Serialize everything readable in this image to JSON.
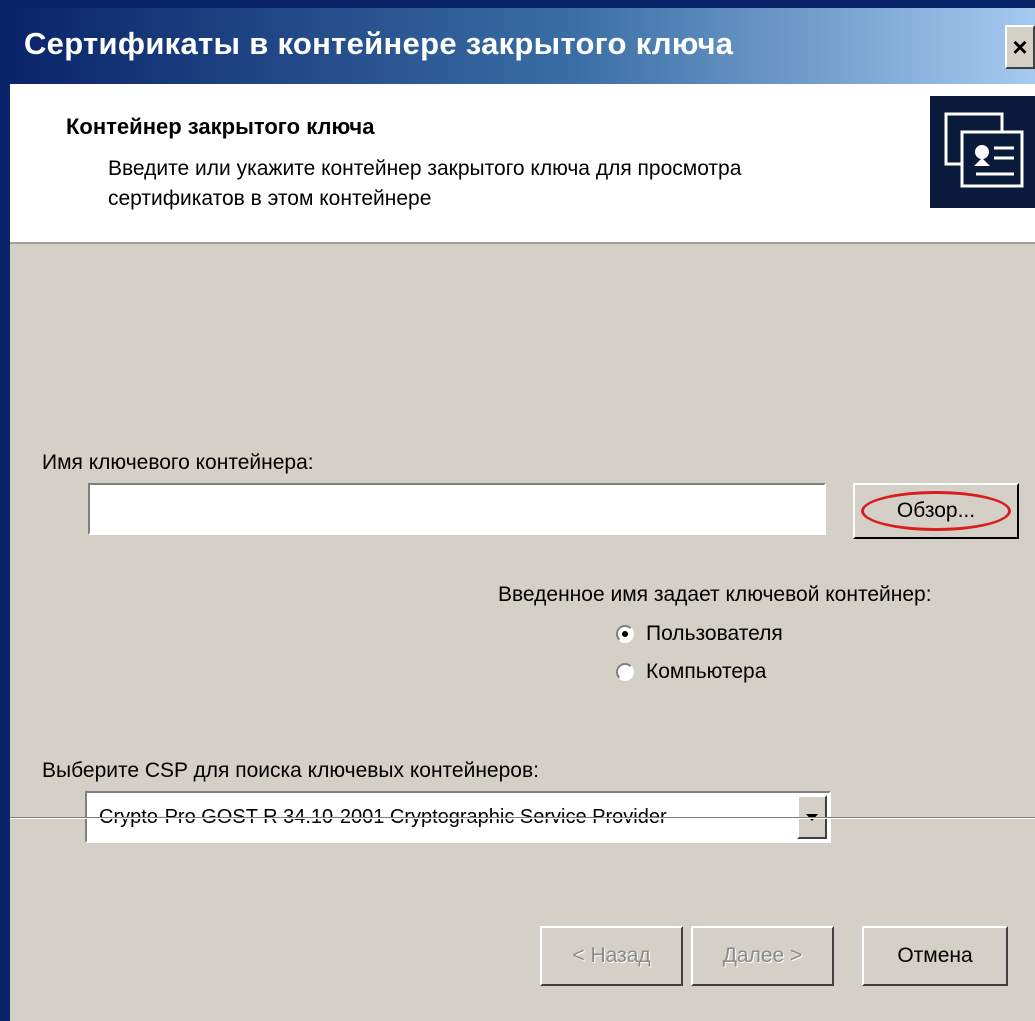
{
  "window": {
    "title": "Сертификаты в контейнере закрытого ключа",
    "close_label": "×"
  },
  "header": {
    "title": "Контейнер закрытого ключа",
    "description": "Введите или укажите контейнер закрытого ключа для просмотра сертификатов в этом контейнере",
    "icon": "certificate-icon"
  },
  "container": {
    "label": "Имя ключевого контейнера:",
    "value": "",
    "browse_label": "Обзор..."
  },
  "scope": {
    "label": "Введенное имя задает ключевой контейнер:",
    "options": [
      {
        "label": "Пользователя",
        "selected": true
      },
      {
        "label": "Компьютера",
        "selected": false
      }
    ]
  },
  "csp": {
    "label": "Выберите CSP для поиска ключевых контейнеров:",
    "selected": "Crypto-Pro GOST R 34.10-2001 Cryptographic Service Provider"
  },
  "buttons": {
    "back": "< Назад",
    "next": "Далее >",
    "cancel": "Отмена"
  },
  "colors": {
    "title_bar": "#0a246a",
    "dialog_bg": "#d4d0c8",
    "highlight_oval": "#d81e1e"
  }
}
